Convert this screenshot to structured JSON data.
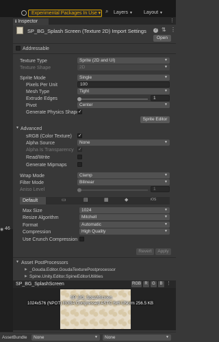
{
  "toolbar": {
    "experimental_packages": "Experimental Packages In Use ▾",
    "layers": "Layers",
    "layout": "Layout"
  },
  "tab": {
    "label": "Inspector"
  },
  "strip": {
    "count": "46"
  },
  "header": {
    "title": "SP_BG_Splash Screen (Texture 2D) Import Settings",
    "open_button": "Open"
  },
  "addressable": {
    "label": "Addressable",
    "checked": false
  },
  "texture": {
    "texture_type_label": "Texture Type",
    "texture_type_value": "Sprite (2D and UI)",
    "texture_shape_label": "Texture Shape",
    "texture_shape_value": "2D",
    "sprite_mode_label": "Sprite Mode",
    "sprite_mode_value": "Single",
    "ppu_label": "Pixels Per Unit",
    "ppu_value": "100",
    "mesh_type_label": "Mesh Type",
    "mesh_type_value": "Tight",
    "extrude_label": "Extrude Edges",
    "extrude_value": "1",
    "pivot_label": "Pivot",
    "pivot_value": "Center",
    "physics_shape_label": "Generate Physics Shape",
    "sprite_editor_button": "Sprite Editor"
  },
  "advanced": {
    "title": "Advanced",
    "srgb_label": "sRGB (Color Texture)",
    "alpha_source_label": "Alpha Source",
    "alpha_source_value": "None",
    "alpha_transparency_label": "Alpha Is Transparency",
    "read_write_label": "Read/Write",
    "mipmaps_label": "Generate Mipmaps"
  },
  "filtering": {
    "wrap_mode_label": "Wrap Mode",
    "wrap_mode_value": "Clamp",
    "filter_mode_label": "Filter Mode",
    "filter_mode_value": "Bilinear",
    "aniso_label": "Aniso Level",
    "aniso_value": "1"
  },
  "platform": {
    "default_tab": "Default",
    "max_size_label": "Max Size",
    "max_size_value": "1024",
    "resize_label": "Resize Algorithm",
    "resize_value": "Mitchell",
    "format_label": "Format",
    "format_value": "Automatic",
    "compression_label": "Compression",
    "compression_value": "High Quality",
    "crunch_label": "Use Crunch Compression"
  },
  "actions": {
    "revert": "Revert",
    "apply": "Apply"
  },
  "postprocessors": {
    "title": "Asset PostProcessors",
    "items": [
      "_Gouda.Editor.GoudaTexturePostprocessor",
      "Spine.Unity.Editor.SpineEditorUtilities"
    ]
  },
  "preview": {
    "title": "SP_BG_SplashScreen",
    "rgb": "RGB",
    "r": "R",
    "g": "G",
    "b": "B",
    "image_name": "SP_BG_SplashScreen",
    "info": "1024x576 (NPOT)  RGBA Compressed ASTC 6x6 UNorm  256.5 KB"
  },
  "footer": {
    "asset_bundle": "AssetBundle",
    "bundle_value": "None",
    "variant_value": "None"
  }
}
